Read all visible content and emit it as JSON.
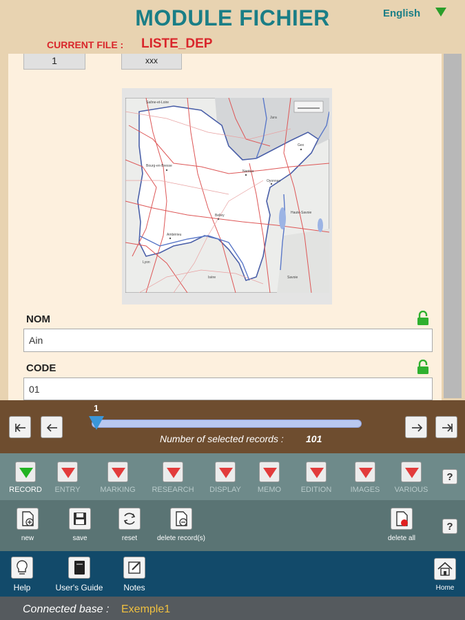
{
  "header": {
    "title": "MODULE FICHIER",
    "language": "English",
    "current_file_label": "CURRENT FILE :",
    "current_file": "LISTE_DEP"
  },
  "top_fields": {
    "number": "1",
    "code_short": "xxx"
  },
  "map": {
    "labels": [
      "Saône-et-Loire",
      "Jura",
      "Bourg-en-Bresse",
      "Nantua",
      "Oyonnax",
      "Gex",
      "Belley",
      "Ambérieu",
      "Haute-Savoie",
      "Lyon",
      "Savoie",
      "Isère"
    ]
  },
  "fields": [
    {
      "label": "NOM",
      "value": "Ain",
      "locked": true
    },
    {
      "label": "CODE",
      "value": "01",
      "locked": true
    }
  ],
  "navigator": {
    "current": "1",
    "progress": 0.01,
    "selected_label": "Number of selected records :",
    "selected_count": "101"
  },
  "tabs": [
    {
      "label": "RECORD",
      "active": true
    },
    {
      "label": "ENTRY",
      "active": false
    },
    {
      "label": "MARKING",
      "active": false
    },
    {
      "label": "RESEARCH",
      "active": false
    },
    {
      "label": "DISPLAY",
      "active": false
    },
    {
      "label": "MEMO",
      "active": false
    },
    {
      "label": "EDITION",
      "active": false
    },
    {
      "label": "IMAGES",
      "active": false
    },
    {
      "label": "VARIOUS",
      "active": false
    }
  ],
  "actions": {
    "new": "new",
    "save": "save",
    "reset": "reset",
    "delete_records": "delete record(s)",
    "delete_all": "delete all"
  },
  "helpbar": {
    "help": "Help",
    "guide": "User's Guide",
    "notes": "Notes",
    "home": "Home"
  },
  "help_symbol": "?",
  "status": {
    "label": "Connected base :",
    "base": "Exemple1"
  },
  "colors": {
    "title": "#1a7e86",
    "current_file": "#d9262b",
    "tab_active_marker": "#22b322",
    "tab_inactive_marker": "#e23b3b"
  }
}
